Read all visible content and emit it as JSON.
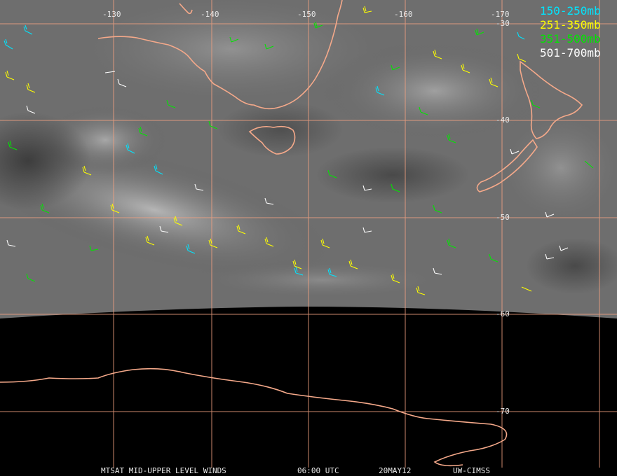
{
  "grid": {
    "longitude_labels": [
      "-130",
      "-140",
      "-150",
      "-160",
      "-170"
    ],
    "latitude_labels": [
      "-30",
      "-40",
      "-50",
      "-60",
      "-70"
    ]
  },
  "legend": [
    {
      "label": "150-250mb",
      "color": "#00e5ff"
    },
    {
      "label": "251-350mb",
      "color": "#ffff00"
    },
    {
      "label": "351-500mb",
      "color": "#00e600"
    },
    {
      "label": "501-700mb",
      "color": "#ffffff"
    }
  ],
  "footer": {
    "product": "MTSAT MID-UPPER LEVEL WINDS",
    "time": "06:00 UTC",
    "date": "20MAY12",
    "source": "UW-CIMSS"
  },
  "colors": {
    "grid": "#f0a080",
    "coast": "#f5a98a",
    "background": "#000000"
  }
}
